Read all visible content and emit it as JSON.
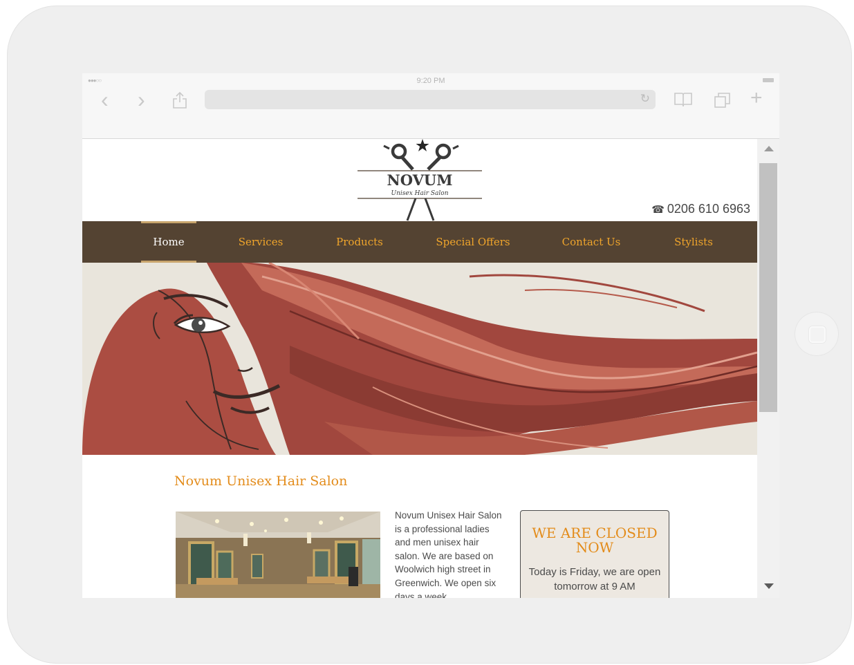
{
  "status_bar": {
    "signal": "●●●○○",
    "time": "9:20 PM"
  },
  "browser": {
    "back_icon": "chevron-left-icon",
    "forward_icon": "chevron-right-icon",
    "share_icon": "share-icon",
    "reload_icon": "reload-icon",
    "bookmarks_icon": "book-icon",
    "tabs_icon": "tabs-icon",
    "new_tab_icon": "plus-icon",
    "glyphs": {
      "back": "‹",
      "forward": "›",
      "share": "⇪",
      "reload": "↻",
      "bookmarks": "▯▯",
      "tabs": "❐",
      "new_tab": "+"
    },
    "url": ""
  },
  "site": {
    "logo": {
      "name": "NOVUM",
      "tagline": "Unisex Hair Salon",
      "icon": "scissors-star-logo"
    },
    "phone": {
      "icon": "phone-icon",
      "glyph": "☎",
      "number": "0206 610 6963"
    },
    "nav": [
      {
        "label": "Home",
        "active": true
      },
      {
        "label": "Services",
        "active": false
      },
      {
        "label": "Products",
        "active": false
      },
      {
        "label": "Special Offers",
        "active": false
      },
      {
        "label": "Contact Us",
        "active": false
      },
      {
        "label": "Stylists",
        "active": false
      }
    ],
    "content": {
      "title": "Novum Unisex Hair Salon",
      "intro": "Novum Unisex Hair Salon is a professional ladies and men unisex hair salon. We are based on Woolwich high street in Greenwich. We open six days a week"
    },
    "closed_box": {
      "title": "WE ARE CLOSED NOW",
      "text": "Today is Friday, we are open tomorrow at 9 AM"
    }
  },
  "colors": {
    "nav_background": "#544332",
    "nav_link": "#f0a52b",
    "nav_active": "#ffffff",
    "accent": "#e38c1b",
    "hair": "#a1473e",
    "hero_background": "#e9e5dc"
  }
}
